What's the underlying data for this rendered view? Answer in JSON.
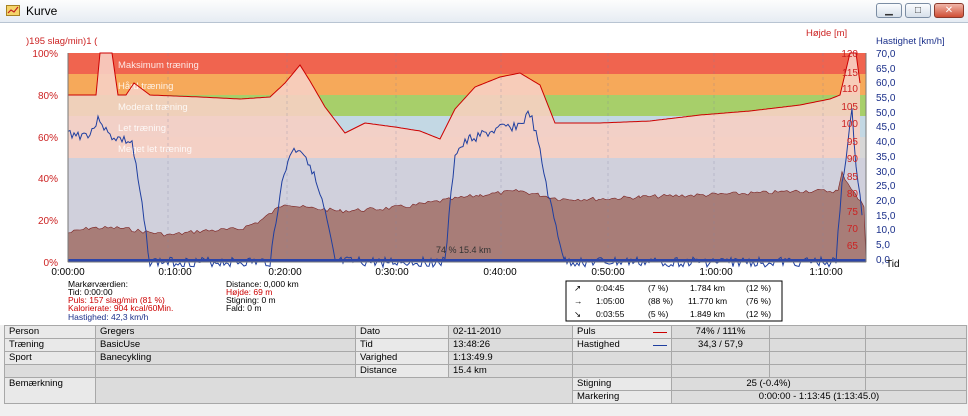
{
  "window": {
    "title": "Kurve"
  },
  "axes": {
    "left_title": ")195 slag/min)1 (",
    "right_title_inner": "Højde [m]",
    "right_title_outer": "Hastighet [km/h]",
    "bottom_right": "Tid",
    "left_ticks": [
      "100%",
      "80%",
      "60%",
      "40%",
      "20%",
      "0%"
    ],
    "height_ticks": [
      "120",
      "115",
      "110",
      "105",
      "100",
      "95",
      "90",
      "85",
      "80",
      "75",
      "70",
      "65"
    ],
    "speed_ticks": [
      "70,0",
      "65,0",
      "60,0",
      "55,0",
      "50,0",
      "45,0",
      "40,0",
      "35,0",
      "30,0",
      "25,0",
      "20,0",
      "15,0",
      "10,0",
      "5,0",
      "0,0"
    ],
    "x_ticks": [
      "0:00:00",
      "0:10:00",
      "0:20:00",
      "0:30:00",
      "0:40:00",
      "0:50:00",
      "1:00:00",
      "1:10:00"
    ]
  },
  "zones": [
    {
      "name": "Maksimum træning",
      "color": "#f0644f"
    },
    {
      "name": "Hård træning",
      "color": "#f6a95a"
    },
    {
      "name": "Moderat træning",
      "color": "#a7cf6a"
    },
    {
      "name": "Let træning",
      "color": "#c3d8e4"
    },
    {
      "name": "Meget let træning",
      "color": "#d7d7d7"
    }
  ],
  "overlay_text": "74 % 15.4 km",
  "marker": {
    "header": "Markørværdien:",
    "tid": "Tid: 0:00:00",
    "puls": "Puls: 157 slag/min (81 %)",
    "kalorierate": "Kalorierate: 904 kcal/60Min.",
    "hastighed": "Hastighed: 42,3 km/h",
    "distance": "Distance: 0,000 km",
    "hojde": "Højde: 69 m",
    "stigning": "Stigning: 0 m",
    "fald": "Fald: 0 m"
  },
  "slope_stats": [
    {
      "icon": "↗",
      "time": "0:04:45",
      "pct": "(7 %)",
      "dist": "1.784 km",
      "dpct": "(12 %)"
    },
    {
      "icon": "→",
      "time": "1:05:00",
      "pct": "(88 %)",
      "dist": "11.770 km",
      "dpct": "(76 %)"
    },
    {
      "icon": "↘",
      "time": "0:03:55",
      "pct": "(5 %)",
      "dist": "1.849 km",
      "dpct": "(12 %)"
    }
  ],
  "info": {
    "person_label": "Person",
    "person": "Gregers",
    "traening_label": "Træning",
    "traening": "BasicUse",
    "sport_label": "Sport",
    "sport": "Banecykling",
    "bemaerkning_label": "Bemærkning",
    "dato_label": "Dato",
    "dato": "02-11-2010",
    "tid_label": "Tid",
    "tid": "13:48:26",
    "varighed_label": "Varighed",
    "varighed": "1:13:49.9",
    "distance_label": "Distance",
    "distance": "15.4 km",
    "puls_label": "Puls",
    "puls": "74% / 111%",
    "hastighed_label": "Hastighed",
    "hastighed": "34,3 / 57,9",
    "stigning_label": "Stigning",
    "stigning": "25 (-0.4%)",
    "markering_label": "Markering",
    "markering": "0:00:00 - 1:13:45 (1:13:45.0)"
  },
  "colors": {
    "pulse": "#cc0000",
    "speed": "#1f3fa0",
    "height_fill": "#a87d78",
    "accent_left": "#cc2222",
    "accent_right": "#1a2f8a"
  }
}
